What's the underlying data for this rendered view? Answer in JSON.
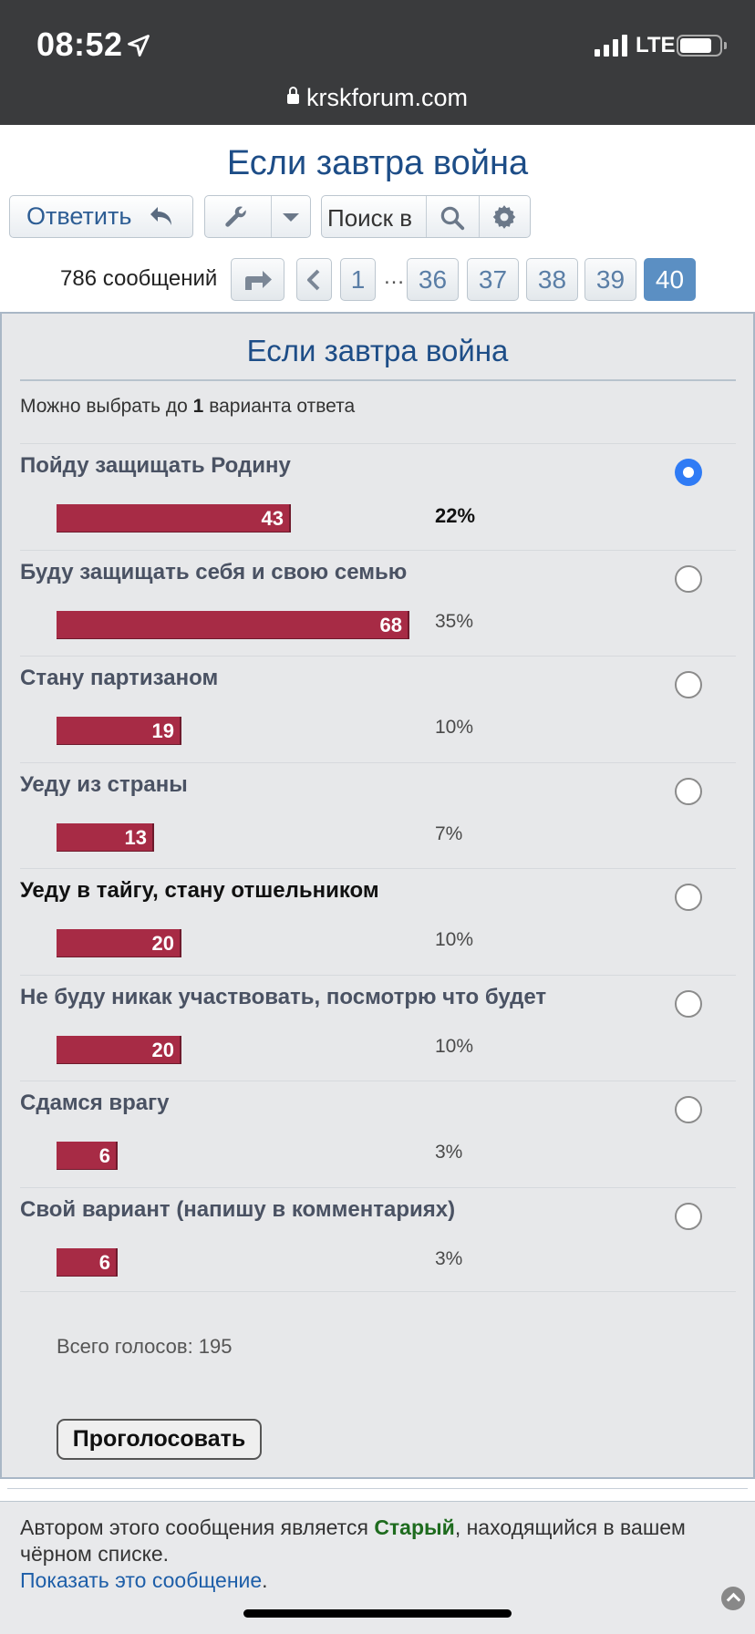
{
  "status_bar": {
    "time": "08:52",
    "network": "LTE",
    "url": "krskforum.com",
    "icons": [
      "location-arrow-icon",
      "signal-icon",
      "battery-icon",
      "lock-icon"
    ]
  },
  "topic": {
    "title": "Если завтра война"
  },
  "toolbar": {
    "reply_label": "Ответить",
    "search_placeholder": "Поиск в",
    "icons": [
      "reply-arrow-icon",
      "wrench-icon",
      "caret-down-icon",
      "search-icon",
      "gear-icon"
    ]
  },
  "pagination": {
    "message_count": "786 сообщений",
    "ellipsis": "…",
    "pages": [
      "1",
      "36",
      "37",
      "38",
      "39",
      "40"
    ],
    "current_page": "40"
  },
  "poll": {
    "title": "Если завтра война",
    "hint_prefix": "Можно выбрать до ",
    "hint_max": "1",
    "hint_suffix": " варианта ответа",
    "options": [
      {
        "label": "Пойду защищать Родину",
        "votes": "43",
        "percent": "22%",
        "fraction": 0.22,
        "selected": true
      },
      {
        "label": "Буду защищать себя и свою семью",
        "votes": "68",
        "percent": "35%",
        "fraction": 0.35,
        "selected": false
      },
      {
        "label": "Стану партизаном",
        "votes": "19",
        "percent": "10%",
        "fraction": 0.1,
        "selected": false
      },
      {
        "label": "Уеду из страны",
        "votes": "13",
        "percent": "7%",
        "fraction": 0.07,
        "selected": false
      },
      {
        "label": "Уеду в тайгу, стану отшельником",
        "votes": "20",
        "percent": "10%",
        "fraction": 0.1,
        "selected": false
      },
      {
        "label": "Не буду никак участвовать, посмотрю что будет",
        "votes": "20",
        "percent": "10%",
        "fraction": 0.1,
        "selected": false
      },
      {
        "label": "Сдамся врагу",
        "votes": "6",
        "percent": "3%",
        "fraction": 0.03,
        "selected": false
      },
      {
        "label": "Свой вариант (напишу в комментариях)",
        "votes": "6",
        "percent": "3%",
        "fraction": 0.03,
        "selected": false
      }
    ],
    "total_votes": "Всего голосов: 195",
    "vote_button": "Проголосовать",
    "bar_color": "#a72b45",
    "radio_color": "#2f7bf5"
  },
  "notice": {
    "text_before": "Автором этого сообщения является ",
    "author": "Старый",
    "text_after": ", находящийся в вашем чёрном списке.",
    "show_link": "Показать это сообщение",
    "link_tail": "."
  }
}
